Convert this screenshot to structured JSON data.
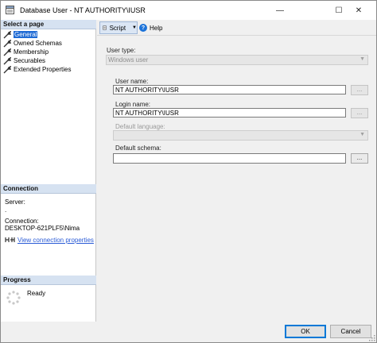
{
  "window": {
    "title": "Database User - NT AUTHORITY\\IUSR",
    "controls": {
      "minimize": "—",
      "maximize": "☐",
      "close": "✕"
    }
  },
  "left_pane": {
    "select_page_header": "Select a page",
    "pages": [
      {
        "label": "General",
        "selected": true
      },
      {
        "label": "Owned Schemas",
        "selected": false
      },
      {
        "label": "Membership",
        "selected": false
      },
      {
        "label": "Securables",
        "selected": false
      },
      {
        "label": "Extended Properties",
        "selected": false
      }
    ],
    "connection": {
      "header": "Connection",
      "server_label": "Server:",
      "server_value": ".",
      "connection_label": "Connection:",
      "connection_value": "DESKTOP-621PLF5\\Nima",
      "view_link": "View connection properties"
    },
    "progress": {
      "header": "Progress",
      "status": "Ready"
    }
  },
  "toolbar": {
    "script_label": "Script",
    "help_label": "Help"
  },
  "form": {
    "user_type_label": "User type:",
    "user_type_value": "Windows user",
    "user_name_label": "User name:",
    "user_name_value": "NT AUTHORITY\\IUSR",
    "login_name_label": "Login name:",
    "login_name_value": "NT AUTHORITY\\IUSR",
    "default_language_label": "Default language:",
    "default_language_value": "",
    "default_schema_label": "Default schema:",
    "default_schema_value": "",
    "browse_label": "..."
  },
  "buttons": {
    "ok": "OK",
    "cancel": "Cancel"
  },
  "colors": {
    "header_bg": "#d6e2f1",
    "selected": "#1e6ad4",
    "link": "#2a5bd6",
    "default_button_border": "#0078d7"
  }
}
